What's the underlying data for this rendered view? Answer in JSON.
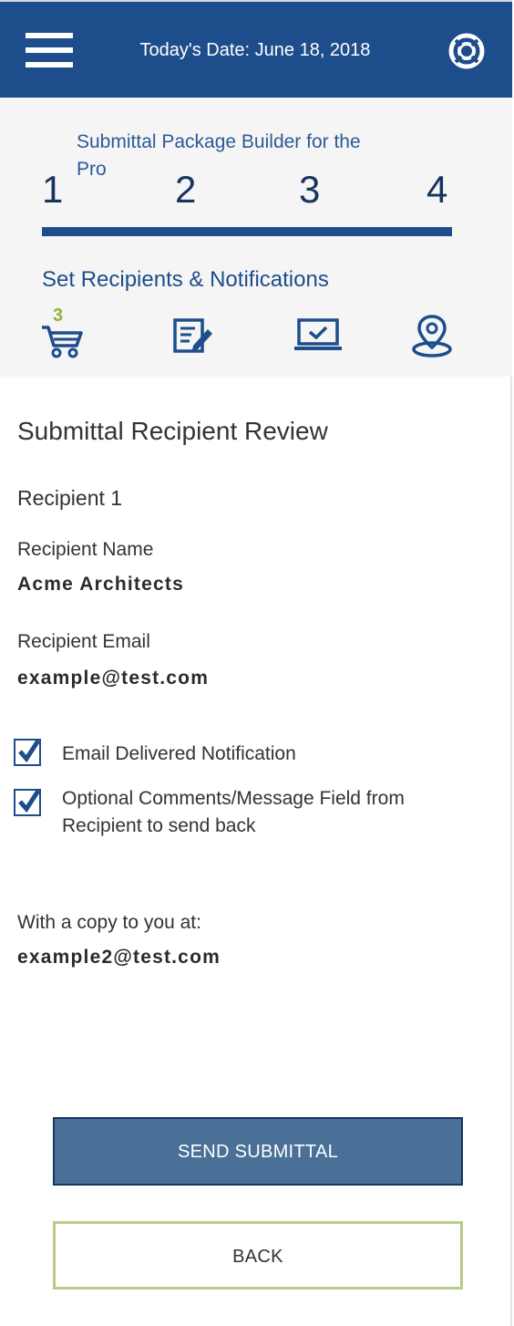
{
  "header": {
    "date_text": "Today's Date: June 18, 2018",
    "menu_icon": "hamburger-menu-icon",
    "help_icon": "lifebuoy-help-icon"
  },
  "stepper": {
    "title": "Submittal Package Builder for the Pro",
    "steps": [
      "1",
      "2",
      "3",
      "4"
    ],
    "progress": 1.0,
    "current_step_label": "Set Recipients & Notifications",
    "icons": [
      "cart-icon",
      "document-edit-icon",
      "laptop-check-icon",
      "location-pin-icon"
    ],
    "cart_count": "3"
  },
  "review": {
    "title": "Submittal Recipient Review",
    "recipient_heading": "Recipient 1",
    "name_label": "Recipient Name",
    "name_value": "Acme Architects",
    "email_label": "Recipient Email",
    "email_value": "example@test.com",
    "options": [
      {
        "label": "Email Delivered Notification",
        "checked": true
      },
      {
        "label": "Optional Comments/Message Field from Recipient to send back",
        "checked": true
      }
    ],
    "copy_label": "With a copy to you at:",
    "copy_value": "example2@test.com"
  },
  "actions": {
    "send_label": "SEND SUBMITTAL",
    "back_label": "BACK"
  },
  "colors": {
    "header_bg": "#1e4d8c",
    "step_dark": "#17335f",
    "accent_green": "#8fb33c",
    "send_button": "#4a7098",
    "back_border": "#b7cc84",
    "panel_bg": "#f5f5f5"
  }
}
